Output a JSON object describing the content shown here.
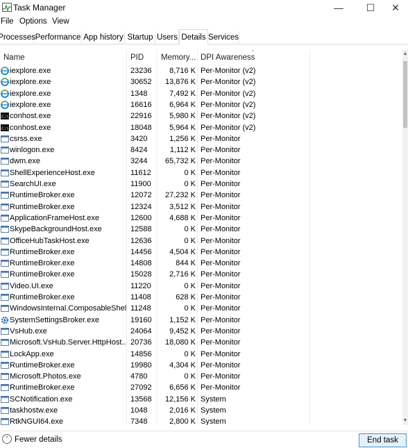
{
  "window": {
    "title": "Task Manager",
    "min_glyph": "—",
    "max_glyph": "☐",
    "close_glyph": "✕"
  },
  "menu": [
    "File",
    "Options",
    "View"
  ],
  "tabs": [
    {
      "label": "Processes",
      "active": false
    },
    {
      "label": "Performance",
      "active": false
    },
    {
      "label": "App history",
      "active": false
    },
    {
      "label": "Startup",
      "active": false
    },
    {
      "label": "Users",
      "active": false
    },
    {
      "label": "Details",
      "active": true
    },
    {
      "label": "Services",
      "active": false
    }
  ],
  "columns": {
    "name": "Name",
    "pid": "PID",
    "memory": "Memory...",
    "dpi": "DPI Awareness"
  },
  "rows": [
    {
      "name": "iexplore.exe",
      "pid": "23236",
      "memory": "8,716 K",
      "dpi": "Per-Monitor (v2)",
      "icon": "ie-icon"
    },
    {
      "name": "iexplore.exe",
      "pid": "30652",
      "memory": "13,876 K",
      "dpi": "Per-Monitor (v2)",
      "icon": "ie-icon"
    },
    {
      "name": "iexplore.exe",
      "pid": "1348",
      "memory": "7,492 K",
      "dpi": "Per-Monitor (v2)",
      "icon": "ie-icon"
    },
    {
      "name": "iexplore.exe",
      "pid": "16616",
      "memory": "6,964 K",
      "dpi": "Per-Monitor (v2)",
      "icon": "ie-icon"
    },
    {
      "name": "conhost.exe",
      "pid": "22916",
      "memory": "5,980 K",
      "dpi": "Per-Monitor (v2)",
      "icon": "console-icon"
    },
    {
      "name": "conhost.exe",
      "pid": "18048",
      "memory": "5,964 K",
      "dpi": "Per-Monitor (v2)",
      "icon": "console-icon"
    },
    {
      "name": "csrss.exe",
      "pid": "3420",
      "memory": "1,256 K",
      "dpi": "Per-Monitor",
      "icon": "window-icon"
    },
    {
      "name": "winlogon.exe",
      "pid": "8424",
      "memory": "1,112 K",
      "dpi": "Per-Monitor",
      "icon": "window-icon"
    },
    {
      "name": "dwm.exe",
      "pid": "3244",
      "memory": "65,732 K",
      "dpi": "Per-Monitor",
      "icon": "window-icon"
    },
    {
      "name": "ShellExperienceHost.exe",
      "pid": "11612",
      "memory": "0 K",
      "dpi": "Per-Monitor",
      "icon": "window-icon"
    },
    {
      "name": "SearchUI.exe",
      "pid": "11900",
      "memory": "0 K",
      "dpi": "Per-Monitor",
      "icon": "window-icon"
    },
    {
      "name": "RuntimeBroker.exe",
      "pid": "12072",
      "memory": "27,232 K",
      "dpi": "Per-Monitor",
      "icon": "window-icon"
    },
    {
      "name": "RuntimeBroker.exe",
      "pid": "12324",
      "memory": "3,512 K",
      "dpi": "Per-Monitor",
      "icon": "window-icon"
    },
    {
      "name": "ApplicationFrameHost.exe",
      "pid": "12600",
      "memory": "4,688 K",
      "dpi": "Per-Monitor",
      "icon": "window-icon"
    },
    {
      "name": "SkypeBackgroundHost.exe",
      "pid": "12588",
      "memory": "0 K",
      "dpi": "Per-Monitor",
      "icon": "window-icon"
    },
    {
      "name": "OfficeHubTaskHost.exe",
      "pid": "12636",
      "memory": "0 K",
      "dpi": "Per-Monitor",
      "icon": "window-icon"
    },
    {
      "name": "RuntimeBroker.exe",
      "pid": "14456",
      "memory": "4,504 K",
      "dpi": "Per-Monitor",
      "icon": "window-icon"
    },
    {
      "name": "RuntimeBroker.exe",
      "pid": "14808",
      "memory": "844 K",
      "dpi": "Per-Monitor",
      "icon": "window-icon"
    },
    {
      "name": "RuntimeBroker.exe",
      "pid": "15028",
      "memory": "2,716 K",
      "dpi": "Per-Monitor",
      "icon": "window-icon"
    },
    {
      "name": "Video.UI.exe",
      "pid": "11220",
      "memory": "0 K",
      "dpi": "Per-Monitor",
      "icon": "window-icon"
    },
    {
      "name": "RuntimeBroker.exe",
      "pid": "11408",
      "memory": "628 K",
      "dpi": "Per-Monitor",
      "icon": "window-icon"
    },
    {
      "name": "WindowsInternal.ComposableShell...",
      "pid": "11248",
      "memory": "0 K",
      "dpi": "Per-Monitor",
      "icon": "window-icon"
    },
    {
      "name": "SystemSettingsBroker.exe",
      "pid": "19160",
      "memory": "1,152 K",
      "dpi": "Per-Monitor",
      "icon": "gear-icon"
    },
    {
      "name": "VsHub.exe",
      "pid": "24064",
      "memory": "9,452 K",
      "dpi": "Per-Monitor",
      "icon": "window-icon"
    },
    {
      "name": "Microsoft.VsHub.Server.HttpHost....",
      "pid": "20736",
      "memory": "18,080 K",
      "dpi": "Per-Monitor",
      "icon": "window-icon"
    },
    {
      "name": "LockApp.exe",
      "pid": "14856",
      "memory": "0 K",
      "dpi": "Per-Monitor",
      "icon": "window-icon"
    },
    {
      "name": "RuntimeBroker.exe",
      "pid": "19980",
      "memory": "4,304 K",
      "dpi": "Per-Monitor",
      "icon": "window-icon"
    },
    {
      "name": "Microsoft.Photos.exe",
      "pid": "4780",
      "memory": "0 K",
      "dpi": "Per-Monitor",
      "icon": "window-icon"
    },
    {
      "name": "RuntimeBroker.exe",
      "pid": "27092",
      "memory": "6,656 K",
      "dpi": "Per-Monitor",
      "icon": "window-icon"
    },
    {
      "name": "SCNotification.exe",
      "pid": "13568",
      "memory": "12,156 K",
      "dpi": "System",
      "icon": "window-icon"
    },
    {
      "name": "taskhostw.exe",
      "pid": "1048",
      "memory": "2,016 K",
      "dpi": "System",
      "icon": "window-icon"
    },
    {
      "name": "RtkNGUI64.exe",
      "pid": "7348",
      "memory": "2,800 K",
      "dpi": "System",
      "icon": "window-icon"
    }
  ],
  "footer": {
    "fewer_details": "Fewer details",
    "end_task": "End task"
  },
  "colors": {
    "accent": "#4a8ed4",
    "selected_tab_border": "#d9d9d9"
  }
}
